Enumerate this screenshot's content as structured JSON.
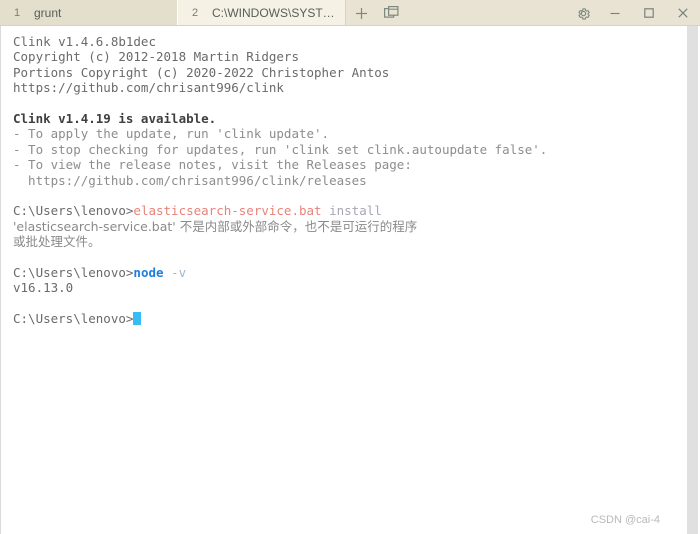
{
  "window": {
    "tabs": [
      {
        "number": "1",
        "title": "grunt",
        "active": false
      },
      {
        "number": "2",
        "title": "C:\\WINDOWS\\SYSTEM...",
        "active": true
      }
    ],
    "toolbar": {
      "new_tab_label": "+",
      "new_tab_icon": "plus-icon",
      "new_window_icon": "windows-duplicate-icon",
      "settings_icon": "gear-icon"
    },
    "controls": {
      "minimize_icon": "minimize-icon",
      "maximize_icon": "maximize-icon",
      "close_icon": "close-icon"
    },
    "colors": {
      "tabbar_bg": "#e8e3d2",
      "tab_active_bg": "#f5f1e4",
      "tab_inactive_bg": "#e4dfcd",
      "terminal_bg": "#ffffff",
      "cursor": "#37bdf3",
      "command_red": "#e8837a",
      "command_blue": "#1f7fe0",
      "scrollbar": "#e0e0e0"
    }
  },
  "terminal": {
    "banner": {
      "line1": "Clink v1.4.6.8b1dec",
      "line2": "Copyright (c) 2012-2018 Martin Ridgers",
      "line3": "Portions Copyright (c) 2020-2022 Christopher Antos",
      "line4": "https://github.com/chrisant996/clink"
    },
    "update_notice": {
      "headline": "Clink v1.4.19 is available.",
      "bullet1": "- To apply the update, run 'clink update'.",
      "bullet2": "- To stop checking for updates, run 'clink set clink.autoupdate false'.",
      "bullet3": "- To view the release notes, visit the Releases page:",
      "bullet4": "  https://github.com/chrisant996/clink/releases"
    },
    "entries": {
      "prompt": "C:\\Users\\lenovo>",
      "cmd1_name": "elasticsearch-service.bat",
      "cmd1_args": " install",
      "cmd1_error_line1": "'elasticsearch-service.bat' 不是内部或外部命令，也不是可运行的程序",
      "cmd1_error_line2": "或批处理文件。",
      "cmd2_name": "node",
      "cmd2_args": " -v",
      "cmd2_output": "v16.13.0"
    }
  },
  "watermark": {
    "text": "CSDN @cai-4"
  }
}
